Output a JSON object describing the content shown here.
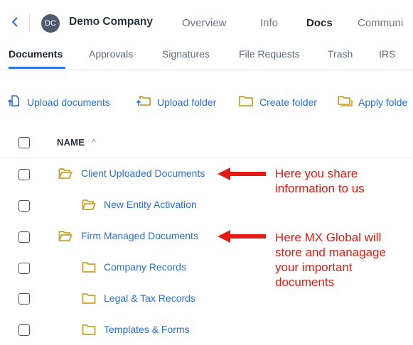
{
  "topnav": {
    "avatar_initials": "DC",
    "company": "Demo Company",
    "tabs": [
      "Overview",
      "Info",
      "Docs",
      "Communi"
    ],
    "active_tab": "Docs"
  },
  "subnav": {
    "tabs": [
      "Documents",
      "Approvals",
      "Signatures",
      "File Requests",
      "Trash",
      "IRS"
    ],
    "active_tab": "Documents"
  },
  "actions": {
    "upload_documents": "Upload documents",
    "upload_folder": "Upload folder",
    "create_folder": "Create folder",
    "apply_folder": "Apply folde"
  },
  "table": {
    "name_header": "NAME",
    "sort_icon": "^",
    "rows": [
      {
        "name": "Client Uploaded Documents",
        "indent": 0,
        "icon": "folder-open-icon"
      },
      {
        "name": "New Entity Activation",
        "indent": 1,
        "icon": "folder-open-icon"
      },
      {
        "name": "Firm Managed Documents",
        "indent": 0,
        "icon": "folder-open-icon"
      },
      {
        "name": "Company Records",
        "indent": 1,
        "icon": "folder-icon"
      },
      {
        "name": "Legal & Tax Records",
        "indent": 1,
        "icon": "folder-icon"
      },
      {
        "name": "Templates & Forms",
        "indent": 1,
        "icon": "folder-icon"
      }
    ]
  },
  "annotations": {
    "note1": "Here you share\ninformation to us",
    "note2": "Here MX Global will\nstore and managage\nyour  important\ndocuments"
  },
  "colors": {
    "accent": "#2c7be5",
    "folder": "#c9a227",
    "annotation": "#e31b12"
  }
}
